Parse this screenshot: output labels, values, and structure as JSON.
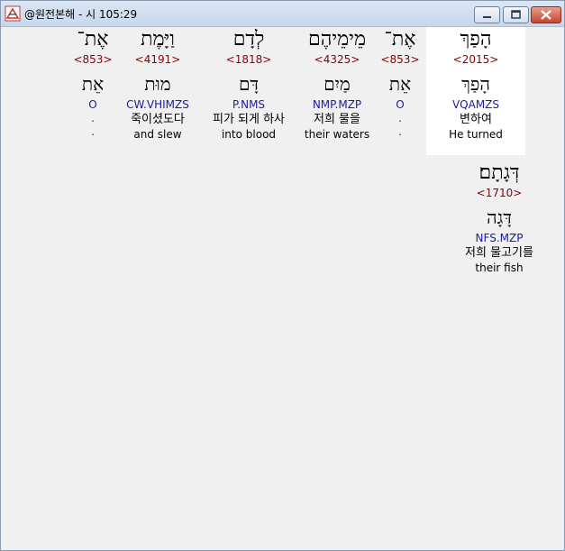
{
  "window": {
    "title": "@원전본해 - 시 105:29"
  },
  "words": [
    {
      "hebrew": "הָפַךְ",
      "strong": "<2015>",
      "lemma": "הָפַךְ",
      "morph": "VQAMZS",
      "korean": "변하여",
      "english": "He turned",
      "highlighted": true
    },
    {
      "hebrew": "אֶת־",
      "strong": "<853>",
      "lemma": "אֵת",
      "morph": "O",
      "korean": ".",
      "english": "."
    },
    {
      "hebrew": "מֵימֵיהֶם",
      "strong": "<4325>",
      "lemma": "מַיִם",
      "morph": "NMP.MZP",
      "korean": "저희 물을",
      "english": "their waters"
    },
    {
      "hebrew": "לְדָם",
      "strong": "<1818>",
      "lemma": "דָּם",
      "morph": "P.NMS",
      "korean": "피가 되게 하사",
      "english": "into blood"
    },
    {
      "hebrew": "וַיָּמֶת",
      "strong": "<4191>",
      "lemma": "מוּת",
      "morph": "CW.VHIMZS",
      "korean": "죽이셨도다",
      "english": "and slew"
    },
    {
      "hebrew": "אֶת־",
      "strong": "<853>",
      "lemma": "אֵת",
      "morph": "O",
      "korean": ".",
      "english": "."
    },
    {
      "hebrew": "דְּגָתָם׃",
      "strong": "<1710>",
      "lemma": "דָּגָה",
      "morph": "NFS.MZP",
      "korean": "저희 물고기를",
      "english": "their fish"
    }
  ]
}
